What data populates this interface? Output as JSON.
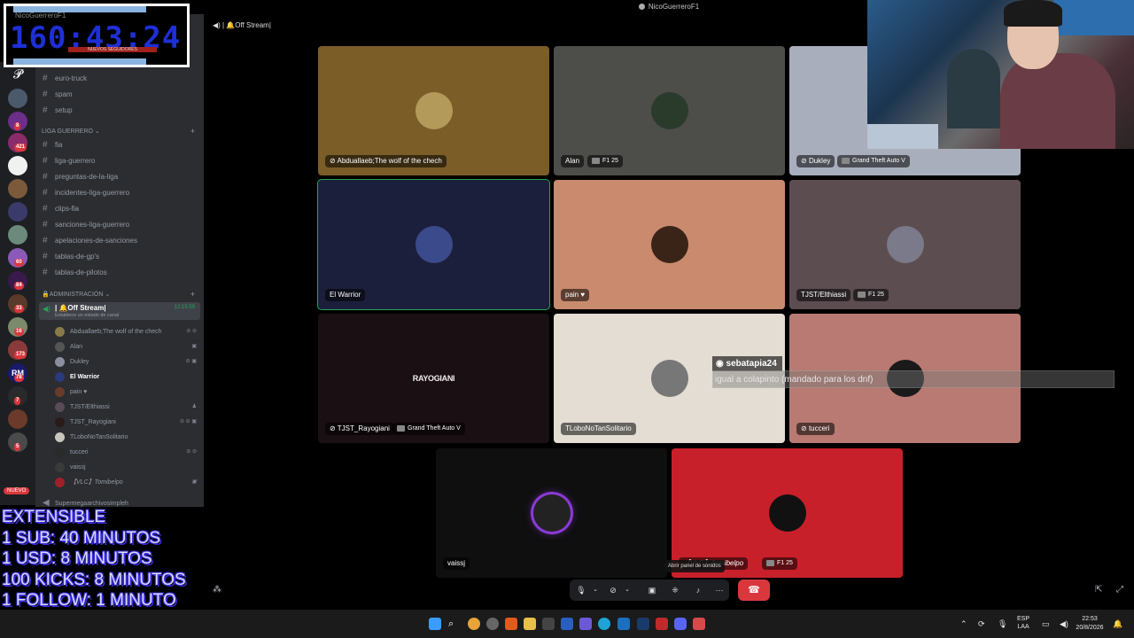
{
  "window": {
    "title": "NicoGuerreroF1",
    "controls": "—  ☐  ✕"
  },
  "overlay_timer": {
    "time": "160:43:24",
    "ghost_text": "NicoGuerreroF1",
    "sub_text": "NUEVOS SEGUIDORES"
  },
  "extensible": {
    "lines": [
      "EXTENSIBLE",
      "1 SUB: 40 MINUTOS",
      "1 USD: 8 MINUTOS",
      "100 KICKS: 8 MINUTOS",
      "1 FOLLOW: 1 MINUTO"
    ]
  },
  "rail": {
    "badges": [
      "8",
      "421",
      "60",
      "84",
      "33",
      "16",
      "173",
      "78",
      "7",
      "5"
    ],
    "new_label": "NUEVO"
  },
  "sidebar": {
    "channels_top": [
      "euro-truck",
      "spam",
      "setup"
    ],
    "category_liga": "LIGA GUERRERO",
    "channels_liga": [
      "fia",
      "liga-guerrero",
      "preguntas-de-la-liga",
      "incidentes-liga-guerrero",
      "clips-fia",
      "sanciones-liga-guerrero",
      "apelaciones-de-sanciones",
      "tablas-de-gp's",
      "tablas-de-pilotos"
    ],
    "category_admin": "🔒ADMINISTRACIÓN",
    "voice_channel": {
      "name": "| 🔔Off Stream|",
      "status": "Establece un estado de canal",
      "time": "12:15:59"
    },
    "members": [
      "Abduallaeb;The wolf of the chech",
      "Alan",
      "Dukley",
      "El Warrior",
      "pain ♥",
      "TJST/Elthiassi",
      "TJST_Rayogiani",
      "TLoboNoTanSolitario",
      "tucceri",
      "vaissj",
      "【VLC】Tomibelpo"
    ],
    "bottom_cut": "Supermegaarchivosimpleh"
  },
  "stage": {
    "title": "| 🔔Off Stream|",
    "tiles": [
      {
        "name": "Abduallaeb;The wolf of the chech",
        "activity": "",
        "bg": "#7a5d27"
      },
      {
        "name": "Alan",
        "activity": "F1 25",
        "bg": "#4d4d4a"
      },
      {
        "name": "Dukley",
        "activity": "Grand Theft Auto V",
        "bg": "#a9aebd"
      },
      {
        "name": "El Warrior",
        "activity": "",
        "bg": "#1c1f3b"
      },
      {
        "name": "pain ♥",
        "activity": "",
        "bg": "#c98a6e"
      },
      {
        "name": "TJST/Elthiassi",
        "activity": "F1 25",
        "bg": "#5c4d50"
      },
      {
        "name": "TJST_Rayogiani",
        "activity": "Grand Theft Auto V",
        "bg": "#1a0f12",
        "inner": "RAYOGIANI"
      },
      {
        "name": "TLoboNoTanSolitario",
        "activity": "",
        "bg": "#e3ddd3"
      },
      {
        "name": "tucceri",
        "activity": "",
        "bg": "#b87a72"
      },
      {
        "name": "vaissj",
        "activity": "",
        "bg": "#0f0f0f"
      },
      {
        "name": "【VLC】Tomibelpo",
        "activity": "F1 25",
        "bg": "#c8202a"
      }
    ]
  },
  "chat": {
    "user": "sebatapia24",
    "message": "igual a colapinto (mandado para los dnf)"
  },
  "controls": {
    "tooltip": "Abrir panel de sonidos",
    "hangup_icon": "☎"
  },
  "taskbar": {
    "lang": "ESP",
    "lang2": "LAA",
    "time": "22:53",
    "date": "20/8/2026"
  }
}
